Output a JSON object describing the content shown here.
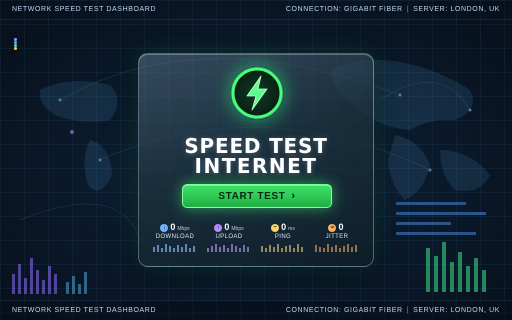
{
  "header": {
    "dashboard_title": "NETWORK SPEED TEST DASHBOARD",
    "connection_label": "CONNECTION:",
    "connection_value": "GIGABIT FIBER",
    "server_label": "SERVER:",
    "server_value": "LONDON, UK"
  },
  "footer": {
    "dashboard_title": "NETWORK SPEED TEST DASHBOARD",
    "connection_label": "CONNECTION:",
    "connection_value": "GIGABIT FIBER",
    "server_label": "SERVER:",
    "server_value": "LONDON, UK"
  },
  "card": {
    "emblem_icon": "lightning-bolt-icon",
    "title_line1": "SPEED TEST",
    "title_line2": "INTERNET",
    "start_button_label": "START TEST",
    "start_button_icon": "chevron-right-icon",
    "metrics": [
      {
        "value": "0",
        "unit": "Mbps",
        "label": "DOWNLOAD",
        "icon": "download-icon",
        "color": "#6fb6ff"
      },
      {
        "value": "0",
        "unit": "Mbps",
        "label": "UPLOAD",
        "icon": "upload-icon",
        "color": "#b48cff"
      },
      {
        "value": "0",
        "unit": "ms",
        "label": "PING",
        "icon": "ping-icon",
        "color": "#ffd36a"
      },
      {
        "value": "0",
        "unit": "",
        "label": "JITTER",
        "icon": "jitter-icon",
        "color": "#ffb060"
      }
    ]
  },
  "colors": {
    "accent_green": "#39e06a",
    "background": "#0b1a2b"
  }
}
